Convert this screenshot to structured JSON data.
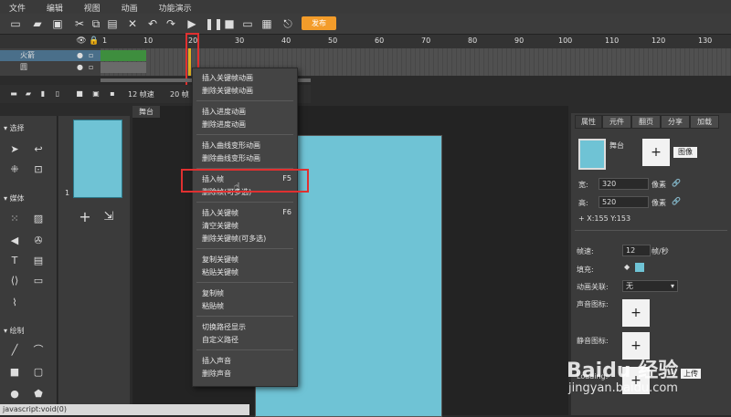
{
  "menubar": [
    "文件",
    "编辑",
    "视图",
    "动画",
    "功能演示"
  ],
  "toolbar": {
    "publish": "发布",
    "publish_color": "#f39c2a"
  },
  "ruler": [
    "1",
    "10",
    "20",
    "30",
    "40",
    "50",
    "60",
    "70",
    "80",
    "90",
    "100",
    "110",
    "120",
    "130"
  ],
  "layers": [
    {
      "name": "火箭"
    },
    {
      "name": "圆"
    }
  ],
  "timeline_bottom": {
    "fps": "12 帧速",
    "frames": "20 帧"
  },
  "left_panel": {
    "select": "选择",
    "media": "媒体",
    "draw": "绘制"
  },
  "scene_number": "1",
  "stage_tab": "舞台",
  "right_panel": {
    "tabs": [
      "属性",
      "元件",
      "翻页",
      "分享",
      "加载"
    ],
    "stage_label": "舞台",
    "image_button": "图像",
    "width_label": "宽:",
    "width_value": "320",
    "width_unit": "像素",
    "height_label": "高:",
    "height_value": "520",
    "height_unit": "像素",
    "coords": "X:155    Y:153",
    "fps_label": "帧速:",
    "fps_value": "12",
    "fps_unit": "帧/秒",
    "fill_label": "填充:",
    "anim_label": "动画关联:",
    "anim_value": "无",
    "sound_label": "声音图标:",
    "mute_label": "静音图标:",
    "loading_label": "Loading:",
    "upload_button": "上传"
  },
  "context_menu": {
    "items": [
      {
        "label": "插入关键帧动画"
      },
      {
        "label": "删除关键帧动画"
      },
      {
        "label": "插入进度动画"
      },
      {
        "label": "删除进度动画"
      },
      {
        "label": "插入曲线变形动画"
      },
      {
        "label": "删除曲线变形动画"
      },
      {
        "label": "插入帧",
        "shortcut": "F5"
      },
      {
        "label": "删除帧(可多选)"
      },
      {
        "label": "插入关键帧",
        "shortcut": "F6"
      },
      {
        "label": "清空关键帧"
      },
      {
        "label": "删除关键帧(可多选)"
      },
      {
        "label": "复制关键帧"
      },
      {
        "label": "粘贴关键帧"
      },
      {
        "label": "复制帧"
      },
      {
        "label": "粘贴帧"
      },
      {
        "label": "切换路径显示"
      },
      {
        "label": "自定义路径"
      },
      {
        "label": "插入声音"
      },
      {
        "label": "删除声音"
      }
    ]
  },
  "status": "javascript:void(0)",
  "watermark": {
    "brand": "Baidu 经验",
    "url": "jingyan.baidu.com"
  },
  "colors": {
    "canvas": "#6fc3d5",
    "highlight": "#e03030",
    "layer_selected": "#4a6f8a"
  }
}
